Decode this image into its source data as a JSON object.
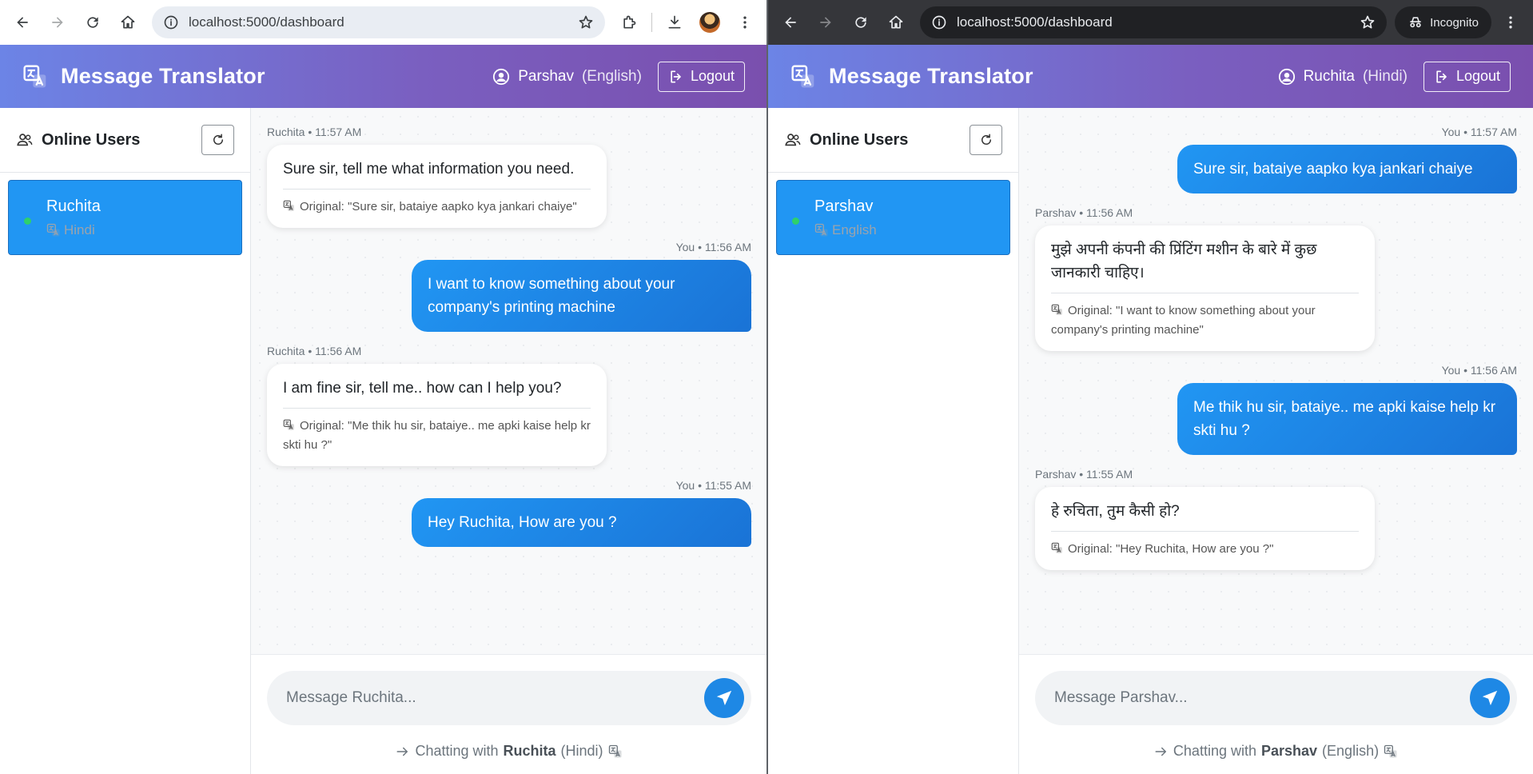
{
  "left": {
    "theme": "light",
    "url": "localhost:5000/dashboard",
    "app_title": "Message Translator",
    "current_user_name": "Parshav",
    "current_user_lang": "(English)",
    "logout_label": "Logout",
    "sidebar_title": "Online Users",
    "online_user": {
      "name": "Ruchita",
      "lang": "Hindi",
      "status_color": "#2fd06b"
    },
    "messages": [
      {
        "dir": "in",
        "meta": "Ruchita • 11:57 AM",
        "text": "Sure sir, tell me what information you need.",
        "original": "Original: \"Sure sir, bataiye aapko kya jankari chaiye\""
      },
      {
        "dir": "out",
        "meta": "You • 11:56 AM",
        "text": "I want to know something about your company's printing machine"
      },
      {
        "dir": "in",
        "meta": "Ruchita • 11:56 AM",
        "text": "I am fine sir, tell me.. how can I help you?",
        "original": "Original: \"Me thik hu sir, bataiye.. me apki kaise help kr skti hu ?\""
      },
      {
        "dir": "out",
        "meta": "You • 11:55 AM",
        "text": "Hey Ruchita, How are you ?"
      }
    ],
    "input_placeholder": "Message Ruchita...",
    "status_prefix": "Chatting with",
    "status_name": "Ruchita",
    "status_lang": "(Hindi)"
  },
  "right": {
    "theme": "dark",
    "url": "localhost:5000/dashboard",
    "incognito_label": "Incognito",
    "app_title": "Message Translator",
    "current_user_name": "Ruchita",
    "current_user_lang": "(Hindi)",
    "logout_label": "Logout",
    "sidebar_title": "Online Users",
    "online_user": {
      "name": "Parshav",
      "lang": "English",
      "status_color": "#2fd06b"
    },
    "messages": [
      {
        "dir": "out",
        "meta": "You • 11:57 AM",
        "text": "Sure sir, bataiye aapko kya jankari chaiye"
      },
      {
        "dir": "in",
        "meta": "Parshav • 11:56 AM",
        "text": "मुझे अपनी कंपनी की प्रिंटिंग मशीन के बारे में कुछ जानकारी चाहिए।",
        "original": "Original: \"I want to know something about your company's printing machine\""
      },
      {
        "dir": "out",
        "meta": "You • 11:56 AM",
        "text": "Me thik hu sir, bataiye.. me apki kaise help kr skti hu ?"
      },
      {
        "dir": "in",
        "meta": "Parshav • 11:55 AM",
        "text": "हे रुचिता, तुम कैसी हो?",
        "original": "Original: \"Hey Ruchita, How are you ?\""
      }
    ],
    "input_placeholder": "Message Parshav...",
    "status_prefix": "Chatting with",
    "status_name": "Parshav",
    "status_lang": "(English)"
  },
  "colors": {
    "header_gradient_start": "#6c84e6",
    "header_gradient_end": "#7a4fae",
    "accent_blue": "#2196f3",
    "online_green": "#2fd06b"
  },
  "icons": {
    "back": "arrow-left-icon",
    "forward": "arrow-right-icon",
    "reload": "reload-icon",
    "home": "home-icon",
    "site_info": "info-icon",
    "bookmark": "star-icon",
    "extensions": "puzzle-icon",
    "download": "download-icon",
    "menu": "kebab-menu-icon",
    "translate": "translate-icon",
    "user": "user-circle-icon",
    "logout": "logout-icon",
    "users": "users-icon",
    "refresh": "refresh-icon",
    "send": "send-icon",
    "chat_arrow": "arrow-right-icon"
  }
}
